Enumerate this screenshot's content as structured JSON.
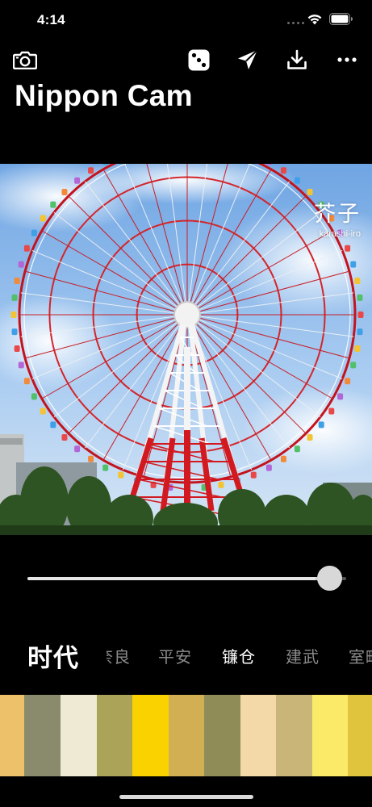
{
  "status_bar": {
    "time": "4:14"
  },
  "toolbar": {
    "camera": "camera-icon",
    "random": "dice-icon",
    "share": "send-icon",
    "save": "download-icon",
    "more": "more-icon"
  },
  "app": {
    "title": "Nippon Cam"
  },
  "photo": {
    "color_name": "芥子",
    "color_romaji": "karashi-iro"
  },
  "slider": {
    "value": 1.0
  },
  "eras": {
    "label": "时代",
    "tabs": [
      {
        "label": "奈良",
        "active": false
      },
      {
        "label": "平安",
        "active": false
      },
      {
        "label": "镰仓",
        "active": true
      },
      {
        "label": "建武",
        "active": false
      },
      {
        "label": "室町",
        "active": false
      }
    ]
  },
  "swatches": [
    "#EDC169",
    "#8A8A6C",
    "#EFEAD3",
    "#ABA458",
    "#F9D200",
    "#D3AF54",
    "#8F8C58",
    "#F3D9A7",
    "#CAB578",
    "#FBEA67",
    "#E0C43E"
  ]
}
